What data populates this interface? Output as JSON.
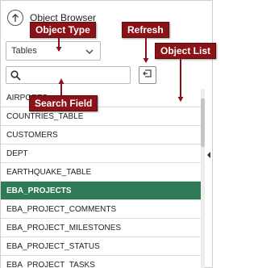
{
  "header": {
    "title": "Object Browser",
    "up_icon": "arrow-up-circle-icon"
  },
  "object_type": {
    "selected": "Tables",
    "icon": "chevron-down-icon"
  },
  "search": {
    "value": "",
    "placeholder": "",
    "icon": "search-icon"
  },
  "refresh": {
    "icon": "refresh-icon"
  },
  "objects": [
    "AIRPORTS",
    "COUNTRIES_TABLE",
    "CUSTOMERS",
    "DEPT",
    "EARTHQUAKE_TABLE",
    "EBA_PROJECTS",
    "EBA_PROJECT_COMMENTS",
    "EBA_PROJECT_MILESTONES",
    "EBA_PROJECT_STATUS",
    "EBA_PROJECT_TASKS"
  ],
  "selected_object": "EBA_PROJECTS",
  "callouts": {
    "object_type": "Object Type",
    "refresh": "Refresh",
    "object_list": "Object List",
    "search_field": "Search Field"
  },
  "colors": {
    "accent": "#2f7a57",
    "callout": "#8b1318"
  }
}
